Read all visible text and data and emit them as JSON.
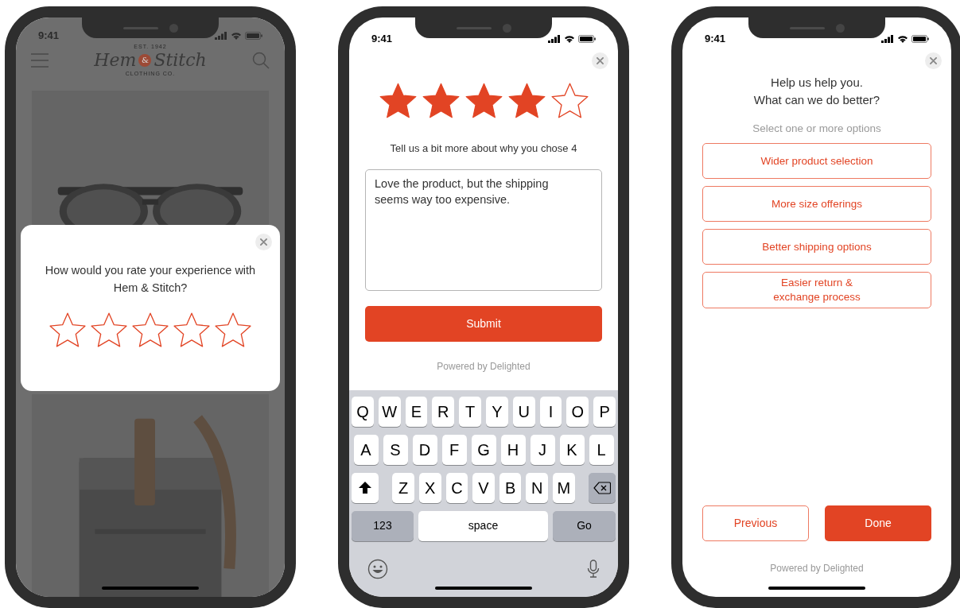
{
  "screens": [
    {
      "kind": "store",
      "time": "9:41",
      "logo": {
        "est": "EST. 1942",
        "left": "Hem",
        "amp": "&",
        "right": "Stitch",
        "sub": "CLOTHING CO."
      },
      "modal": {
        "question": "How would you rate your experience with Hem & Stitch?",
        "stars": 0
      }
    },
    {
      "kind": "comment",
      "time": "9:41",
      "stars": 4,
      "prompt": "Tell us a bit more about why you chose 4",
      "comment": "Love the product, but the shipping seems way too expensive.",
      "submit": "Submit",
      "footer": "Powered by Delighted",
      "keyboard": {
        "top_keys": [
          "Q",
          "W",
          "E",
          "R",
          "T",
          "Y",
          "U",
          "I",
          "O",
          "P"
        ],
        "middle_keys": [
          "A",
          "S",
          "D",
          "F",
          "G",
          "H",
          "J",
          "K",
          "L"
        ],
        "bottom_keys": [
          "Z",
          "X",
          "C",
          "V",
          "B",
          "N",
          "M"
        ],
        "bottom": [
          {
            "kind": "mode",
            "label": "123"
          },
          {
            "kind": "space",
            "label": "space"
          },
          {
            "kind": "action",
            "label": "Go"
          }
        ]
      }
    },
    {
      "kind": "options",
      "time": "9:41",
      "title": "Help us help you.\nWhat can we do better?",
      "hint": "Select one or more options",
      "options": [
        {
          "label": "Wider product selection",
          "selected": false
        },
        {
          "label": "More size offerings",
          "selected": false
        },
        {
          "label": "Better shipping options",
          "selected": false
        },
        {
          "label": "Easier return &\nexchange process",
          "selected": false
        }
      ],
      "previous": "Previous",
      "done": "Done",
      "footer": "Powered by Delighted"
    }
  ]
}
